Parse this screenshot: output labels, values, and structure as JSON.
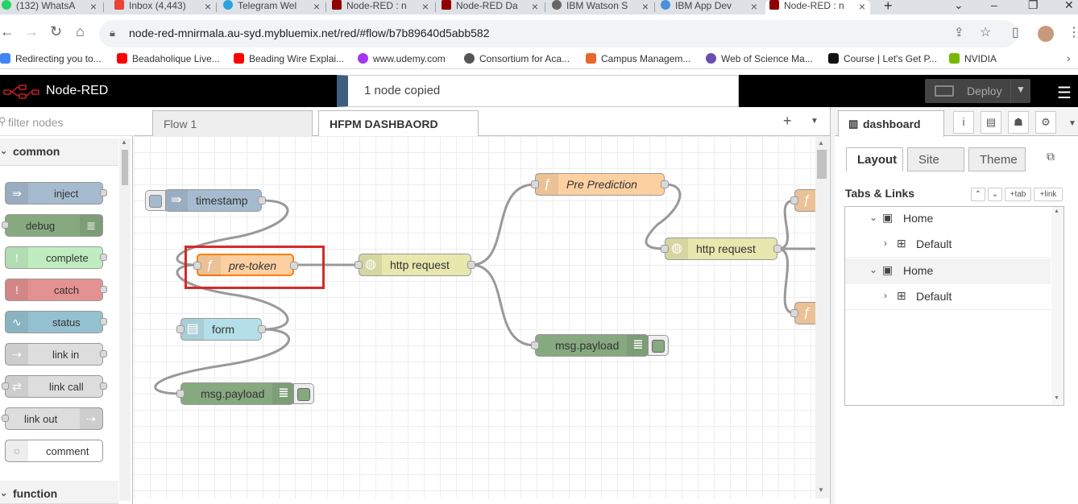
{
  "browser": {
    "tabs": [
      {
        "label": "(132) WhatsA",
        "icon": "whatsapp-icon",
        "color": "#25d366"
      },
      {
        "label": "Inbox (4,443)",
        "icon": "gmail-icon",
        "color": "#ea4335"
      },
      {
        "label": "Telegram Wel",
        "icon": "telegram-icon",
        "color": "#2aa3df"
      },
      {
        "label": "Node-RED : n",
        "icon": "node-red-icon",
        "color": "#8f0000"
      },
      {
        "label": "Node-RED Da",
        "icon": "node-red-icon",
        "color": "#8f0000"
      },
      {
        "label": "IBM Watson S",
        "icon": "watson-icon",
        "color": "#666666"
      },
      {
        "label": "IBM App Dev",
        "icon": "cloud-icon",
        "color": "#4a90d9"
      },
      {
        "label": "Node-RED : n",
        "icon": "node-red-icon",
        "color": "#8f0000"
      }
    ],
    "url": "node-red-mnirmala.au-syd.mybluemix.net/red/#flow/b7b89640d5abb582",
    "bookmarks": [
      {
        "label": "Redirecting you to...",
        "icon": "google-icon",
        "color": "#4285f4"
      },
      {
        "label": "Beadaholique Live...",
        "icon": "youtube-icon",
        "color": "#ff0000"
      },
      {
        "label": "Beading Wire Explai...",
        "icon": "youtube-icon",
        "color": "#ff0000"
      },
      {
        "label": "www.udemy.com",
        "icon": "udemy-icon",
        "color": "#a435f0"
      },
      {
        "label": "Consortium for Aca...",
        "icon": "globe-icon",
        "color": "#555555"
      },
      {
        "label": "Campus Managem...",
        "icon": "campus-icon",
        "color": "#e8652c"
      },
      {
        "label": "Web of Science Ma...",
        "icon": "wos-icon",
        "color": "#6a4fb3"
      },
      {
        "label": "Course | Let's Get P...",
        "icon": "coursera-icon",
        "color": "#111111"
      },
      {
        "label": "NVIDIA",
        "icon": "nvidia-icon",
        "color": "#76b900"
      }
    ]
  },
  "header": {
    "title": "Node-RED",
    "notification": "1 node copied",
    "deploy_label": "Deploy"
  },
  "palette": {
    "filter_placeholder": "filter nodes",
    "categories": [
      "common",
      "function"
    ],
    "nodes": [
      {
        "label": "inject",
        "color": "#a6bbcf",
        "icon": "inject-icon"
      },
      {
        "label": "debug",
        "color": "#87a980",
        "icon": "debug-icon"
      },
      {
        "label": "complete",
        "color": "#c0edc0",
        "icon": "complete-icon"
      },
      {
        "label": "catch",
        "color": "#e49191",
        "icon": "catch-icon"
      },
      {
        "label": "status",
        "color": "#94c1d0",
        "icon": "status-icon"
      },
      {
        "label": "link in",
        "color": "#dddddd",
        "icon": "link-in-icon"
      },
      {
        "label": "link call",
        "color": "#dddddd",
        "icon": "link-call-icon"
      },
      {
        "label": "link out",
        "color": "#dddddd",
        "icon": "link-out-icon"
      },
      {
        "label": "comment",
        "color": "#ffffff",
        "icon": "comment-icon"
      }
    ]
  },
  "workspace": {
    "tabs": [
      "Flow 1",
      "HFPM DASHBAORD"
    ],
    "nodes": {
      "timestamp": "timestamp",
      "pre_token": "pre-token",
      "form": "form",
      "msg_payload_1": "msg.payload",
      "http_request_1": "http request",
      "pre_prediction": "Pre Prediction",
      "http_request_2": "http request",
      "msg_payload_2": "msg.payload"
    }
  },
  "sidebar": {
    "active_tab": "dashboard",
    "subtabs": [
      "Layout",
      "Site",
      "Theme"
    ],
    "section_title": "Tabs & Links",
    "tab_button": "+tab",
    "link_button": "+link",
    "tree": [
      {
        "label": "Home",
        "type": "tab"
      },
      {
        "label": "Default",
        "type": "group"
      },
      {
        "label": "Home",
        "type": "tab"
      },
      {
        "label": "Default",
        "type": "group"
      }
    ]
  }
}
